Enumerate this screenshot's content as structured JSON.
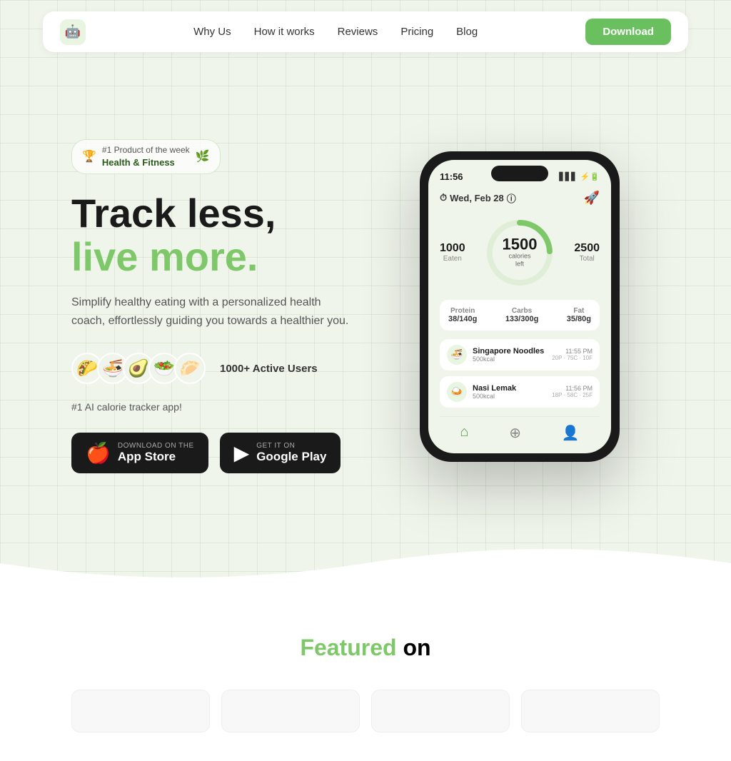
{
  "nav": {
    "logo_emoji": "🤖",
    "links": [
      {
        "label": "Why Us",
        "id": "why-us"
      },
      {
        "label": "How it works",
        "id": "how-it-works"
      },
      {
        "label": "Reviews",
        "id": "reviews"
      },
      {
        "label": "Pricing",
        "id": "pricing"
      },
      {
        "label": "Blog",
        "id": "blog"
      }
    ],
    "download_label": "Download"
  },
  "hero": {
    "badge": {
      "rank": "#1 Product of the week",
      "category": "Health & Fitness"
    },
    "title_black": "Track less,",
    "title_green": "live more.",
    "subtitle": "Simplify healthy eating with a personalized health coach, effortlessly guiding you towards a healthier you.",
    "user_avatars": [
      "🌮",
      "🍜",
      "🥑",
      "🥗",
      "🥟"
    ],
    "user_count": "1000+ Active Users",
    "tagline": "#1 AI calorie tracker app!",
    "app_store_label_small": "Download on the",
    "app_store_label_large": "App Store",
    "play_store_label_small": "GET IT ON",
    "play_store_label_large": "Google Play"
  },
  "phone": {
    "time": "11:56",
    "signal": "▋▋▋",
    "battery": "🔋",
    "date": "Wed, Feb 28",
    "calories_eaten": "1000",
    "calories_eaten_label": "Eaten",
    "calories_left": "1500",
    "calories_left_unit": "calories",
    "calories_left_label": "left",
    "calories_total": "2500",
    "calories_total_label": "Total",
    "macros": [
      {
        "label": "Protein",
        "value": "38/140g"
      },
      {
        "label": "Carbs",
        "value": "133/300g"
      },
      {
        "label": "Fat",
        "value": "35/80g"
      }
    ],
    "food_log": [
      {
        "name": "Singapore Noodles",
        "calories": "500kcal",
        "time": "11:55 PM",
        "macros": "20P · 75C · 10F"
      },
      {
        "name": "Nasi Lemak",
        "calories": "500kcal",
        "time": "11:56 PM",
        "macros": "18P · 58C · 25F"
      }
    ]
  },
  "featured": {
    "title_green": "Featured",
    "title_black": "on"
  }
}
